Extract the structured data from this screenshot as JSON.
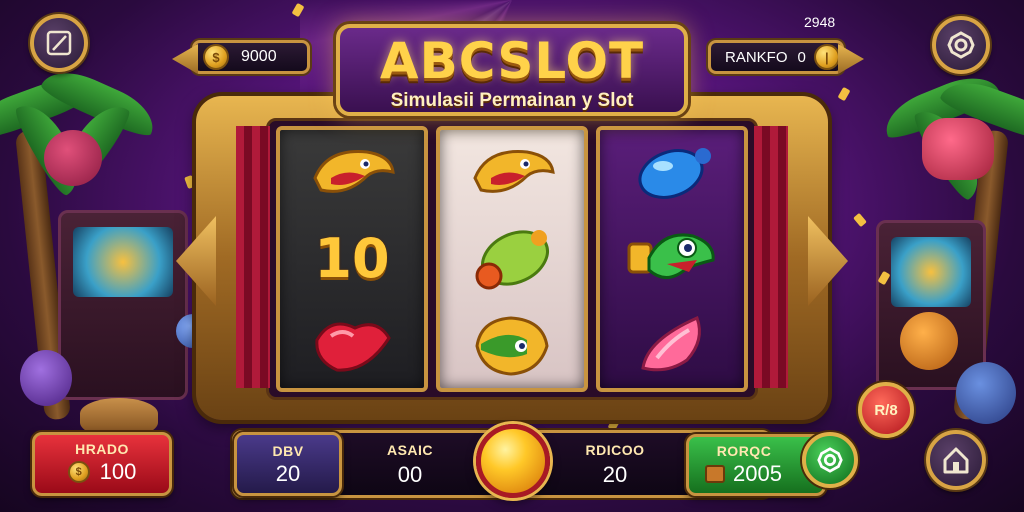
{
  "header": {
    "left_balance": "9000",
    "top_right_counter": "2948",
    "rank_label": "RANKFO",
    "rank_value": "0"
  },
  "logo": {
    "title": "ABCSLOT",
    "subtitle": "Simulasii Permainan y Slot"
  },
  "reels": [
    {
      "symbols": [
        "golden-fish-icon",
        "ten-symbol",
        "red-gem-icon"
      ],
      "ten_text": "10"
    },
    {
      "symbols": [
        "golden-fish-icon",
        "green-gem-icon",
        "golden-fish-icon"
      ]
    },
    {
      "symbols": [
        "blue-candy-icon",
        "green-fish-icon",
        "pink-gem-icon"
      ]
    }
  ],
  "bottom": {
    "left_box_label": "HRADO",
    "left_box_value": "100",
    "bet_label": "DBV",
    "bet_value": "20",
    "asaic_label": "ASAIC",
    "asaic_value": "00",
    "rdicoo_label": "RDICOO",
    "rdicoo_value": "20",
    "green_label": "RORQC",
    "green_value": "2005",
    "red_badge_text": "R/8"
  },
  "colors": {
    "gold": "#e0b048",
    "purple_bg": "#5a1680",
    "red_box": "#c8202c",
    "green_box": "#2e9a3a",
    "spin": "#ffc828"
  }
}
